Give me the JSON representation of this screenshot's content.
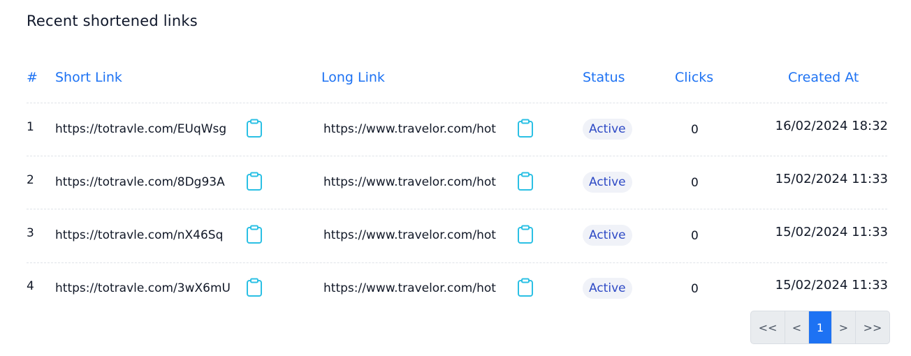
{
  "title": "Recent shortened links",
  "table": {
    "headers": {
      "index": "#",
      "short": "Short Link",
      "long": "Long Link",
      "status": "Status",
      "clicks": "Clicks",
      "created": "Created At"
    },
    "rows": [
      {
        "index": "1",
        "short": "https://totravle.com/EUqWsg",
        "long": "https://www.travelor.com/hot",
        "status": "Active",
        "clicks": "0",
        "created": "16/02/2024 18:32"
      },
      {
        "index": "2",
        "short": "https://totravle.com/8Dg93A",
        "long": "https://www.travelor.com/hot",
        "status": "Active",
        "clicks": "0",
        "created": "15/02/2024 11:33"
      },
      {
        "index": "3",
        "short": "https://totravle.com/nX46Sq",
        "long": "https://www.travelor.com/hot",
        "status": "Active",
        "clicks": "0",
        "created": "15/02/2024 11:33"
      },
      {
        "index": "4",
        "short": "https://totravle.com/3wX6mU",
        "long": "https://www.travelor.com/hot",
        "status": "Active",
        "clicks": "0",
        "created": "15/02/2024 11:33"
      }
    ]
  },
  "pagination": {
    "first": "<<",
    "prev": "<",
    "current": "1",
    "next": ">",
    "last": ">>"
  },
  "colors": {
    "accent": "#1d72f3",
    "copy_icon": "#2bc0e4",
    "badge_text": "#2d49c5",
    "badge_bg": "#f0f2f8"
  },
  "icons": {
    "copy": "clipboard-icon"
  }
}
